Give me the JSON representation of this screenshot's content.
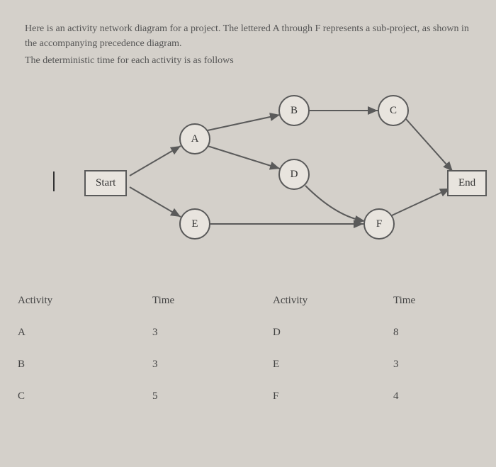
{
  "intro": {
    "p1": "Here is an activity network diagram for a project. The lettered A through F represents a sub-project, as shown in the accompanying precedence diagram.",
    "p2": "The deterministic time for each activity is as follows"
  },
  "nodes": {
    "start": "Start",
    "A": "A",
    "B": "B",
    "C": "C",
    "D": "D",
    "E": "E",
    "F": "F",
    "end": "End"
  },
  "table": {
    "headers": {
      "activity": "Activity",
      "time": "Time"
    },
    "left": [
      {
        "activity": "A",
        "time": "3"
      },
      {
        "activity": "B",
        "time": "3"
      },
      {
        "activity": "C",
        "time": "5"
      }
    ],
    "right": [
      {
        "activity": "D",
        "time": "8"
      },
      {
        "activity": "E",
        "time": "3"
      },
      {
        "activity": "F",
        "time": "4"
      }
    ]
  },
  "chart_data": {
    "type": "network-diagram",
    "nodes": [
      "Start",
      "A",
      "B",
      "C",
      "D",
      "E",
      "F",
      "End"
    ],
    "edges": [
      [
        "Start",
        "A"
      ],
      [
        "Start",
        "E"
      ],
      [
        "A",
        "B"
      ],
      [
        "A",
        "D"
      ],
      [
        "B",
        "C"
      ],
      [
        "D",
        "F"
      ],
      [
        "E",
        "F"
      ],
      [
        "C",
        "End"
      ],
      [
        "F",
        "End"
      ]
    ],
    "activity_times": {
      "A": 3,
      "B": 3,
      "C": 5,
      "D": 8,
      "E": 3,
      "F": 4
    }
  }
}
